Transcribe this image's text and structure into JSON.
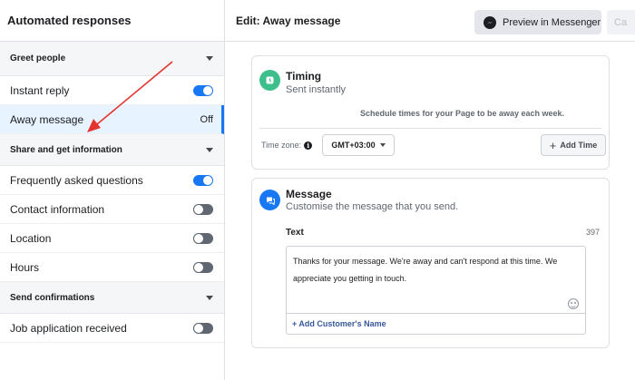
{
  "sidebar": {
    "title": "Automated responses",
    "sections": [
      {
        "label": "Greet people",
        "items": [
          {
            "label": "Instant reply",
            "state": "on"
          },
          {
            "label": "Away message",
            "state_text": "Off",
            "active": true
          }
        ]
      },
      {
        "label": "Share and get information",
        "items": [
          {
            "label": "Frequently asked questions",
            "state": "on"
          },
          {
            "label": "Contact information",
            "state": "off"
          },
          {
            "label": "Location",
            "state": "off"
          },
          {
            "label": "Hours",
            "state": "off"
          }
        ]
      },
      {
        "label": "Send confirmations",
        "items": [
          {
            "label": "Job application received",
            "state": "off"
          }
        ]
      }
    ]
  },
  "header": {
    "title": "Edit: Away message",
    "preview_label": "Preview in Messenger",
    "cancel_label": "Ca"
  },
  "timing": {
    "title": "Timing",
    "subtitle": "Sent instantly",
    "schedule_note": "Schedule times for your Page to be away each week.",
    "timezone_label": "Time zone:",
    "timezone_value": "GMT+03:00",
    "add_time_label": "Add Time"
  },
  "message": {
    "title": "Message",
    "subtitle": "Customise the message that you send.",
    "text_label": "Text",
    "char_count": "397",
    "body_line1": "Thanks for your message. We're away and can't respond at this time. We",
    "body_line2": "appreciate you getting in touch.",
    "add_name_label": "+ Add Customer's Name"
  },
  "colors": {
    "accent": "#1877f2",
    "annotation_arrow": "#e3342f",
    "timing_icon": "#3dbf8c"
  }
}
